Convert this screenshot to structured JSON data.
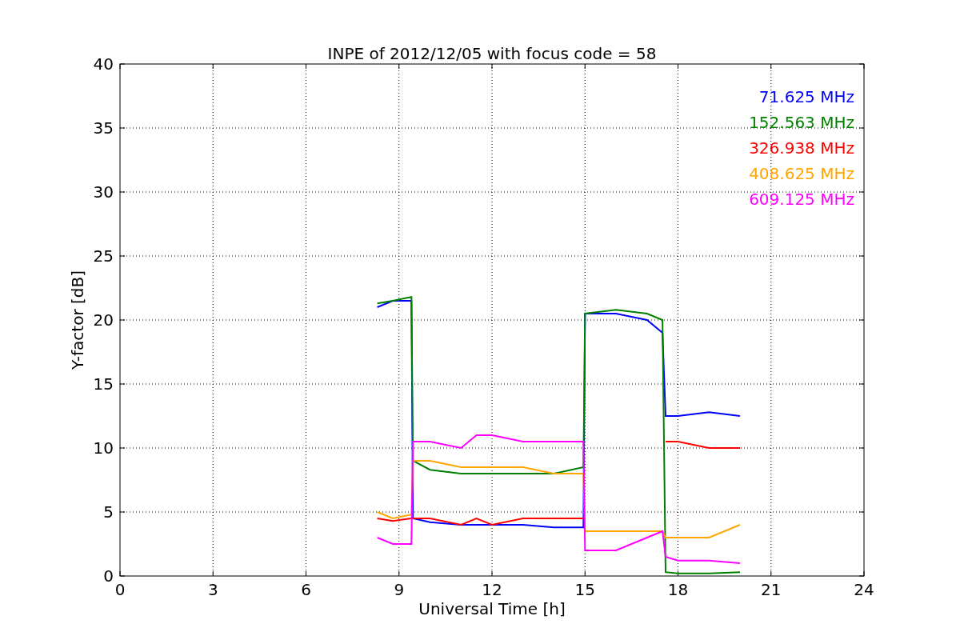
{
  "figure": {
    "chart_data": {
      "type": "line",
      "grid": true,
      "title": "INPE of 2012/12/05 with focus code = 58",
      "xlabel": "Universal Time [h]",
      "ylabel": "Y-factor [dB]",
      "xlim": [
        0,
        24
      ],
      "ylim": [
        0,
        40
      ],
      "xticks": [
        0,
        3,
        6,
        9,
        12,
        15,
        18,
        21,
        24
      ],
      "yticks": [
        0,
        5,
        10,
        15,
        20,
        25,
        30,
        35,
        40
      ],
      "x": [
        8.3,
        8.8,
        9.4,
        9.45,
        10,
        11,
        11.5,
        12,
        13,
        14,
        14.95,
        15.0,
        16,
        17,
        17.5,
        17.6,
        18,
        19,
        20
      ],
      "series": [
        {
          "name": "71.625 MHz",
          "color": "#0000ff",
          "values": [
            21,
            21.5,
            21.5,
            4.5,
            4.2,
            4,
            4,
            4,
            4,
            3.8,
            3.8,
            20.5,
            20.5,
            20,
            19,
            12.5,
            12.5,
            12.8,
            12.5
          ]
        },
        {
          "name": "152.563 MHz",
          "color": "#008000",
          "values": [
            21.3,
            21.5,
            21.8,
            9,
            8.3,
            8,
            8,
            8,
            8,
            8,
            8.5,
            20.5,
            20.8,
            20.5,
            20,
            0.3,
            0.2,
            0.2,
            0.3
          ]
        },
        {
          "name": "326.938 MHz",
          "color": "#ff0000",
          "values": [
            4.5,
            4.3,
            4.5,
            4.5,
            4.5,
            4,
            4.5,
            4,
            4.5,
            4.5,
            4.5,
            null,
            null,
            null,
            null,
            10.5,
            10.5,
            10,
            10
          ]
        },
        {
          "name": "408.625 MHz",
          "color": "#ffa500",
          "values": [
            5,
            4.5,
            4.8,
            9,
            9,
            8.5,
            8.5,
            8.5,
            8.5,
            8,
            8,
            3.5,
            3.5,
            3.5,
            3.5,
            3,
            3,
            3,
            4
          ]
        },
        {
          "name": "609.125 MHz",
          "color": "#ff00ff",
          "values": [
            3,
            2.5,
            2.5,
            10.5,
            10.5,
            10,
            11,
            11,
            10.5,
            10.5,
            10.5,
            2,
            2,
            3,
            3.5,
            1.5,
            1.2,
            1.2,
            1
          ]
        }
      ]
    }
  }
}
